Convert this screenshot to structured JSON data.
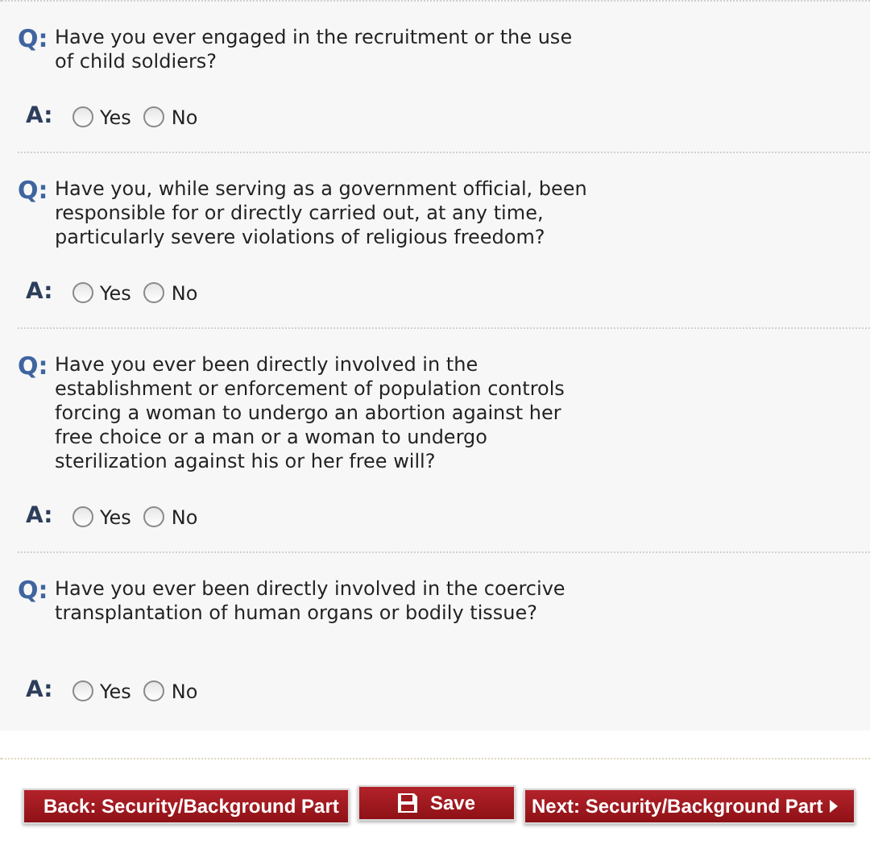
{
  "questions": [
    {
      "q_label": "Q:",
      "text": "Have you ever engaged in the recruitment or the use of child soldiers?",
      "a_label": "A:",
      "options": [
        {
          "label": "Yes",
          "selected": false
        },
        {
          "label": "No",
          "selected": false
        }
      ]
    },
    {
      "q_label": "Q:",
      "text": "Have you, while serving as a government official, been responsible for or directly carried out, at any time, particularly severe violations of religious freedom?",
      "a_label": "A:",
      "options": [
        {
          "label": "Yes",
          "selected": false
        },
        {
          "label": "No",
          "selected": false
        }
      ]
    },
    {
      "q_label": "Q:",
      "text": "Have you ever been directly involved in the establishment or enforcement of population controls forcing a woman to undergo an abortion against her free choice or a man or a woman to undergo sterilization against his or her free will?",
      "a_label": "A:",
      "options": [
        {
          "label": "Yes",
          "selected": false
        },
        {
          "label": "No",
          "selected": false
        }
      ]
    },
    {
      "q_label": "Q:",
      "text": "Have you ever been directly involved in the coercive transplantation of human organs or bodily tissue?",
      "a_label": "A:",
      "options": [
        {
          "label": "Yes",
          "selected": false
        },
        {
          "label": "No",
          "selected": false
        }
      ]
    }
  ],
  "buttons": [
    {
      "kind": "back",
      "label": "Back: Security/Background Part"
    },
    {
      "kind": "save",
      "label": "Save"
    },
    {
      "kind": "next",
      "label": "Next: Security/Background Part"
    }
  ]
}
